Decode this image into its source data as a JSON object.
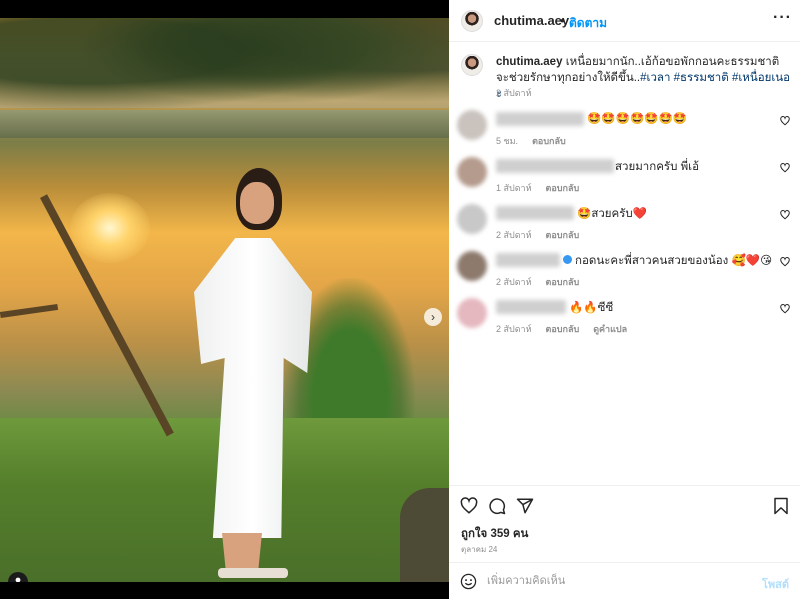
{
  "post": {
    "username": "chutima.aey",
    "separator": "•",
    "follow_label": "ติดตาม",
    "more_label": "···"
  },
  "caption": {
    "username": "chutima.aey",
    "text": "เหนื่อยมากนัก..เอ้ก้อขอพักกอนคะธรรมชาติจะช่วยรักษาทุกอย่างให้ดีขึ้น..",
    "hashtags": [
      "#เวลา",
      "#ธรรมชาติ",
      "#เหนื่อยเนอะ"
    ],
    "date": "2 สัปดาห์"
  },
  "comments": [
    {
      "text": "🤩🤩🤩🤩🤩🤩🤩",
      "time": "5 ชม.",
      "reply": "ตอบกลับ",
      "translate": "",
      "verified": false,
      "avatar_color": "#c9c2bd"
    },
    {
      "text": "สวยมากครับ พี่เอ้",
      "time": "1 สัปดาห์",
      "reply": "ตอบกลับ",
      "translate": "",
      "verified": false,
      "avatar_color": "#b59b8d"
    },
    {
      "text": "🤩สวยครับ❤️",
      "time": "2 สัปดาห์",
      "reply": "ตอบกลับ",
      "translate": "",
      "verified": false,
      "avatar_color": "#c8c8c8"
    },
    {
      "text": "กอดนะคะพี่สาวคนสวยของน้อง 🥰❤️😘",
      "time": "2 สัปดาห์",
      "reply": "ตอบกลับ",
      "translate": "",
      "verified": true,
      "avatar_color": "#8d7a6d"
    },
    {
      "text": "🔥🔥ซีซี",
      "time": "2 สัปดาห์",
      "reply": "ตอบกลับ",
      "translate": "ดูคำแปล",
      "verified": false,
      "avatar_color": "#e5b8bf"
    }
  ],
  "actions": {
    "icons": [
      "heart-icon",
      "comment-icon",
      "share-icon",
      "bookmark-icon"
    ],
    "likes_text": "ถูกใจ 359 คน",
    "post_date": "ตุลาคม 24"
  },
  "add_comment": {
    "placeholder": "เพิ่มความคิดเห็น",
    "post_label": "โพสต์"
  },
  "carousel": {
    "slides": 6,
    "active": 0
  },
  "colors": {
    "accent": "#0095f6",
    "muted": "#8e8e8e",
    "hashtag": "#00376b"
  }
}
